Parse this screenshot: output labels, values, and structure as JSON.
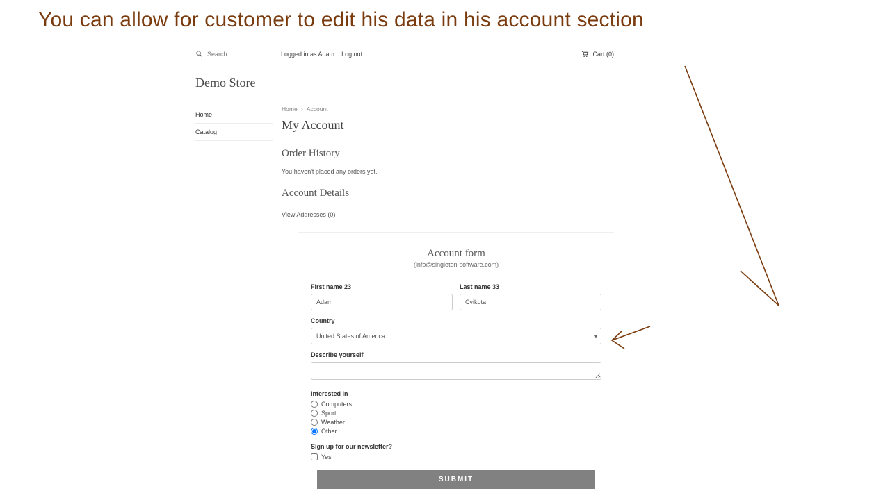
{
  "hero": "You can allow for customer to edit his data in his account section",
  "topbar": {
    "search_placeholder": "Search",
    "logged_in_text": "Logged in as Adam",
    "logout_label": "Log out",
    "cart_label": "Cart (0)"
  },
  "store": {
    "title": "Demo Store"
  },
  "sidebar": {
    "items": [
      {
        "label": "Home"
      },
      {
        "label": "Catalog"
      }
    ]
  },
  "breadcrumb": {
    "home": "Home",
    "current": "Account"
  },
  "page": {
    "title": "My Account",
    "order_history_heading": "Order History",
    "no_orders_text": "You haven't placed any orders yet.",
    "account_details_heading": "Account Details",
    "view_addresses_label": "View Addresses (0)"
  },
  "form": {
    "title": "Account form",
    "subtitle": "(info@singleton-software.com)",
    "first_name_label": "First name 23",
    "first_name_value": "Adam",
    "last_name_label": "Last name 33",
    "last_name_value": "Cvikota",
    "country_label": "Country",
    "country_value": "United States of America",
    "describe_label": "Describe yourself",
    "describe_value": "",
    "interested_heading": "Interested In",
    "interested_options": [
      "Computers",
      "Sport",
      "Weather",
      "Other"
    ],
    "interested_selected": "Other",
    "newsletter_heading": "Sign up for our newsletter?",
    "newsletter_option": "Yes",
    "newsletter_checked": false,
    "submit_label": "SUBMIT"
  }
}
